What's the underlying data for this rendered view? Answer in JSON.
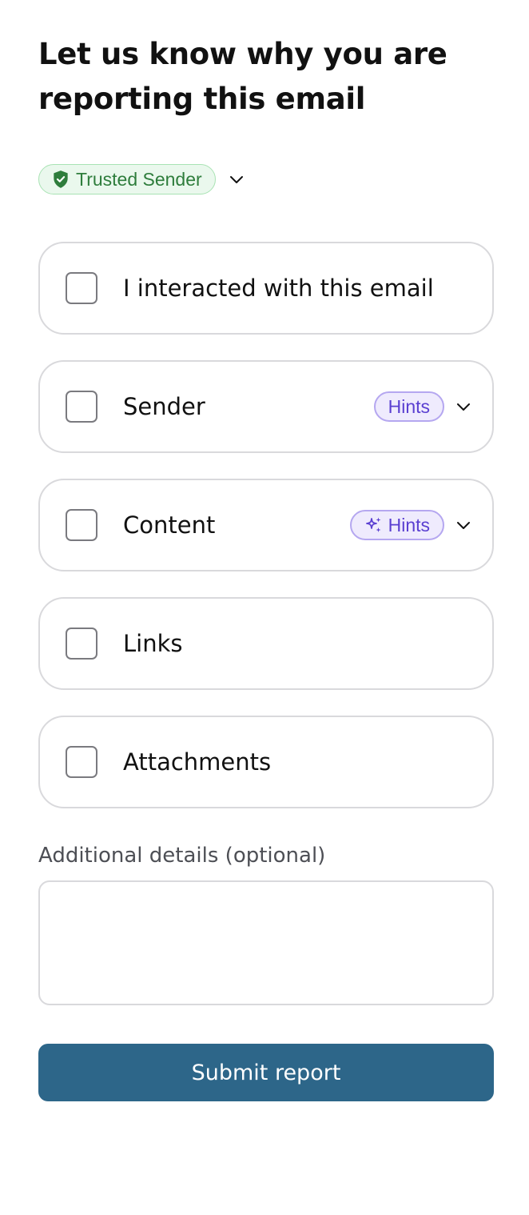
{
  "header": {
    "title": "Let us know why you are reporting this email"
  },
  "sender_badge": {
    "label": "Trusted Sender",
    "icon": "shield-check-icon",
    "color": "#2e7d3c",
    "background": "#eaf8ed"
  },
  "options": [
    {
      "label": "I interacted with this email",
      "checked": false
    },
    {
      "label": "Sender",
      "checked": false,
      "hints_label": "Hints"
    },
    {
      "label": "Content",
      "checked": false,
      "hints_label": "Hints",
      "hints_icon": "sparkle-icon"
    },
    {
      "label": "Links",
      "checked": false
    },
    {
      "label": "Attachments",
      "checked": false
    }
  ],
  "details": {
    "label": "Additional details (optional)",
    "value": "",
    "placeholder": ""
  },
  "submit": {
    "label": "Submit report",
    "color": "#2d6689"
  },
  "colors": {
    "hints_text": "#5a3fd1",
    "hints_background": "#efebfd",
    "border": "#d9d9dc"
  }
}
